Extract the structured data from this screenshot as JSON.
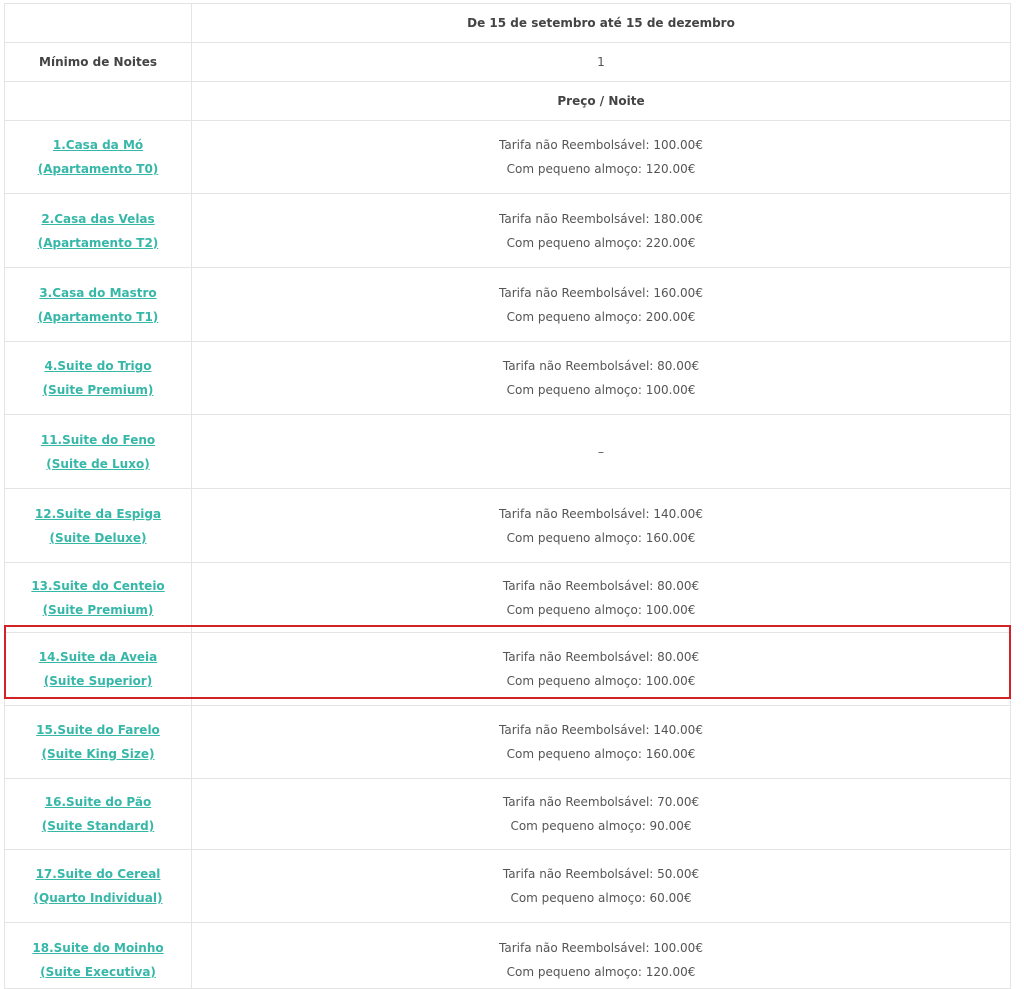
{
  "header": {
    "period": "De 15 de setembro até 15 de dezembro",
    "min_nights_label": "Mínimo de Noites",
    "min_nights_value": "1",
    "price_header": "Preço / Noite"
  },
  "rooms": [
    {
      "name": "1.Casa da Mó",
      "type": "(Apartamento T0)",
      "rate": "Tarifa não Reembolsável: 100.00€",
      "breakfast": "Com pequeno almoço: 120.00€"
    },
    {
      "name": "2.Casa das Velas",
      "type": "(Apartamento T2)",
      "rate": "Tarifa não Reembolsável: 180.00€",
      "breakfast": "Com pequeno almoço: 220.00€"
    },
    {
      "name": "3.Casa do Mastro",
      "type": "(Apartamento T1)",
      "rate": "Tarifa não Reembolsável: 160.00€",
      "breakfast": "Com pequeno almoço: 200.00€"
    },
    {
      "name": "4.Suite do Trigo",
      "type": "(Suite Premium)",
      "rate": "Tarifa não Reembolsável: 80.00€",
      "breakfast": "Com pequeno almoço: 100.00€"
    },
    {
      "name": "11.Suite do Feno",
      "type": "(Suite de Luxo)",
      "rate": "–",
      "breakfast": ""
    },
    {
      "name": "12.Suite da Espiga",
      "type": "(Suite Deluxe)",
      "rate": "Tarifa não Reembolsável: 140.00€",
      "breakfast": "Com pequeno almoço: 160.00€"
    },
    {
      "name": "13.Suite do Centeio",
      "type": "(Suite Premium)",
      "rate": "Tarifa não Reembolsável: 80.00€",
      "breakfast": "Com pequeno almoço: 100.00€"
    },
    {
      "name": "14.Suite da Aveia",
      "type": "(Suite Superior)",
      "rate": "Tarifa não Reembolsável: 80.00€",
      "breakfast": "Com pequeno almoço: 100.00€"
    },
    {
      "name": "15.Suite do Farelo",
      "type": "(Suite King Size)",
      "rate": "Tarifa não Reembolsável: 140.00€",
      "breakfast": "Com pequeno almoço: 160.00€"
    },
    {
      "name": "16.Suite do Pão",
      "type": "(Suite Standard)",
      "rate": "Tarifa não Reembolsável: 70.00€",
      "breakfast": "Com pequeno almoço: 90.00€"
    },
    {
      "name": "17.Suite do Cereal",
      "type": "(Quarto Individual)",
      "rate": "Tarifa não Reembolsável: 50.00€",
      "breakfast": "Com pequeno almoço: 60.00€"
    },
    {
      "name": "18.Suite do Moinho",
      "type": "(Suite Executiva)",
      "rate": "Tarifa não Reembolsável: 100.00€",
      "breakfast": "Com pequeno almoço: 120.00€"
    }
  ],
  "colors": {
    "link": "#36b7a8",
    "highlight_border": "#d2232a",
    "grid": "#e4e4e4"
  }
}
